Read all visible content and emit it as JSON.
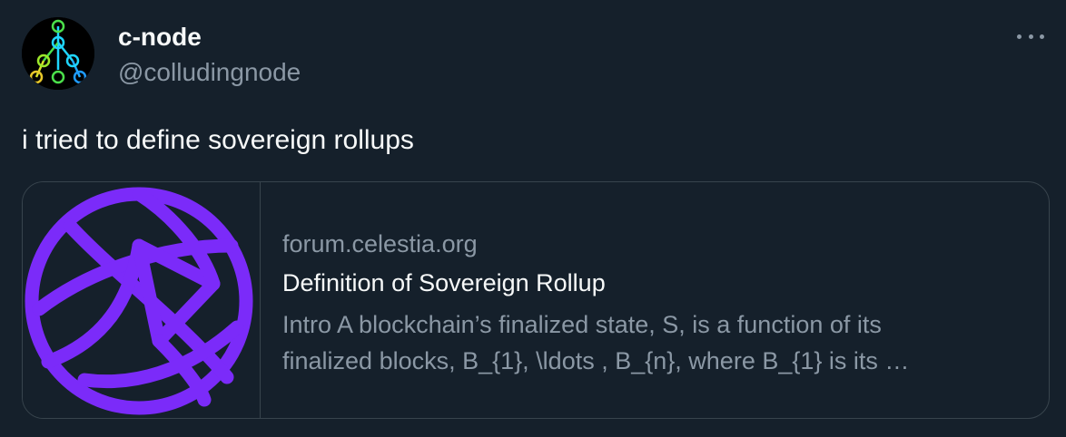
{
  "tweet": {
    "author": {
      "display_name": "c-node",
      "handle": "@colludingnode",
      "avatar_icon": "network-tree-avatar"
    },
    "more_icon": "more-horizontal-icon",
    "text": "i tried to define sovereign rollups",
    "card": {
      "domain": "forum.celestia.org",
      "title": "Definition of Sovereign Rollup",
      "description_lines": [
        "Intro A blockchain’s finalized state, S, is a function of its",
        "finalized blocks, B_{1}, \\ldots , B_{n}, where B_{1} is its …"
      ],
      "image_icon": "celestia-logo",
      "accent_color": "#7b2bf9"
    }
  },
  "colors": {
    "background": "#15202b",
    "text_primary": "#f7f9f9",
    "text_secondary": "#8b98a5",
    "border": "#38444d"
  }
}
